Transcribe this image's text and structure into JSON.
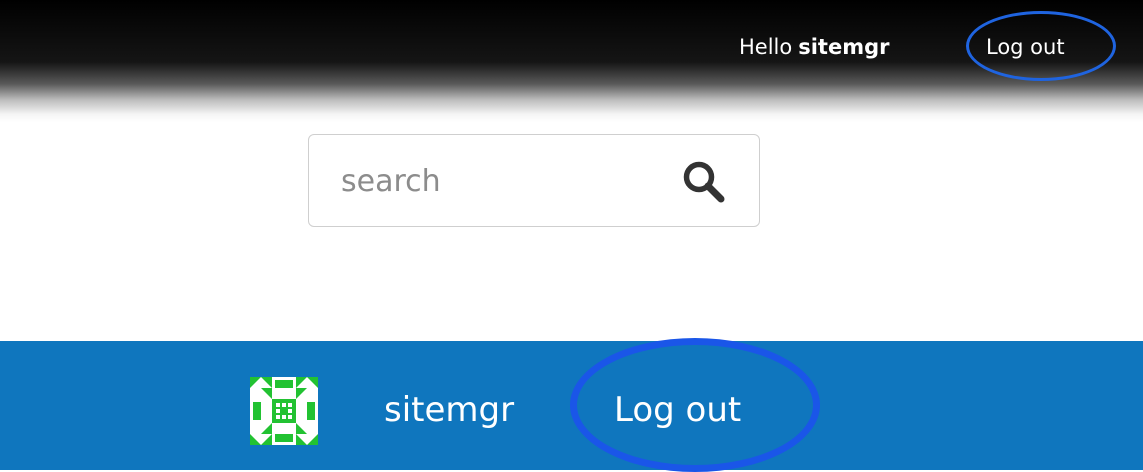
{
  "header": {
    "greeting_prefix": "Hello",
    "username": "sitemgr",
    "logout_label": "Log out"
  },
  "search": {
    "placeholder": "search",
    "value": "",
    "icon": "magnifier-icon"
  },
  "user_bar": {
    "avatar_icon": "identicon-avatar",
    "username": "sitemgr",
    "logout_label": "Log out"
  },
  "colors": {
    "header_bg": "#000000",
    "user_bar_bg": "#0f76be",
    "highlight_circle": "#1a56e8",
    "avatar_green": "#22c232"
  }
}
